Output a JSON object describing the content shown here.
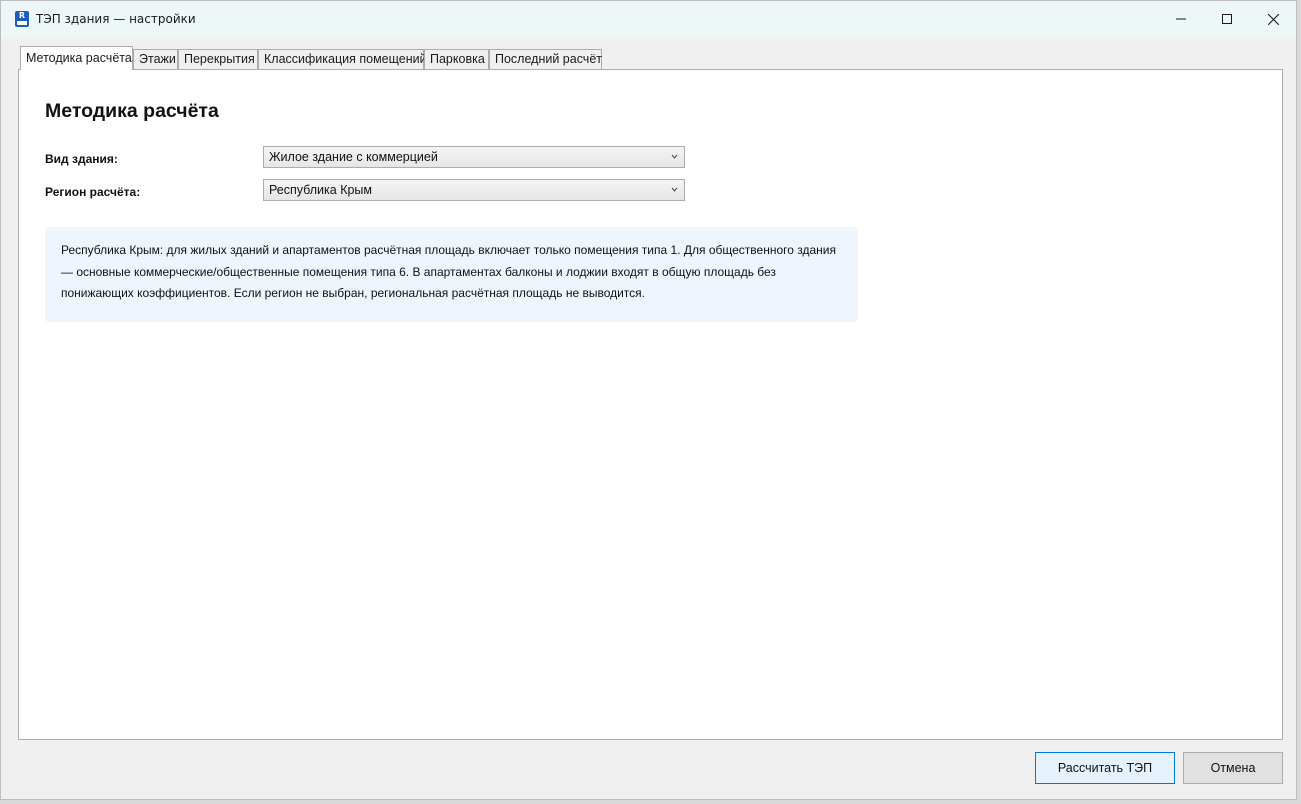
{
  "window": {
    "title": "ТЭП здания — настройки",
    "app_icon": "revit-app-icon",
    "controls": [
      "minimize-icon",
      "maximize-icon",
      "close-icon"
    ]
  },
  "tabs": [
    {
      "label": "Методика расчёта",
      "active": true
    },
    {
      "label": "Этажи",
      "active": false
    },
    {
      "label": "Перекрытия",
      "active": false
    },
    {
      "label": "Классификация помещений",
      "active": false
    },
    {
      "label": "Парковка",
      "active": false
    },
    {
      "label": "Последний расчёт",
      "active": false
    }
  ],
  "main": {
    "heading": "Методика расчёта",
    "building_type": {
      "label": "Вид здания:",
      "value": "Жилое здание с коммерцией"
    },
    "region": {
      "label": "Регион расчёта:",
      "value": "Республика Крым"
    },
    "info_text": "Республика Крым: для жилых зданий и апартаментов расчётная площадь включает только помещения типа 1. Для общественного здания — основные коммерческие/общественные помещения типа 6. В апартаментах балконы и лоджии входят в общую площадь без понижающих коэффициентов. Если регион не выбран, региональная расчётная площадь не выводится."
  },
  "footer": {
    "calculate_label": "Рассчитать ТЭП",
    "cancel_label": "Отмена"
  },
  "colors": {
    "titlebar": "#eef7f7",
    "info_background": "#eef5fd",
    "primary_border": "#0078d7"
  }
}
